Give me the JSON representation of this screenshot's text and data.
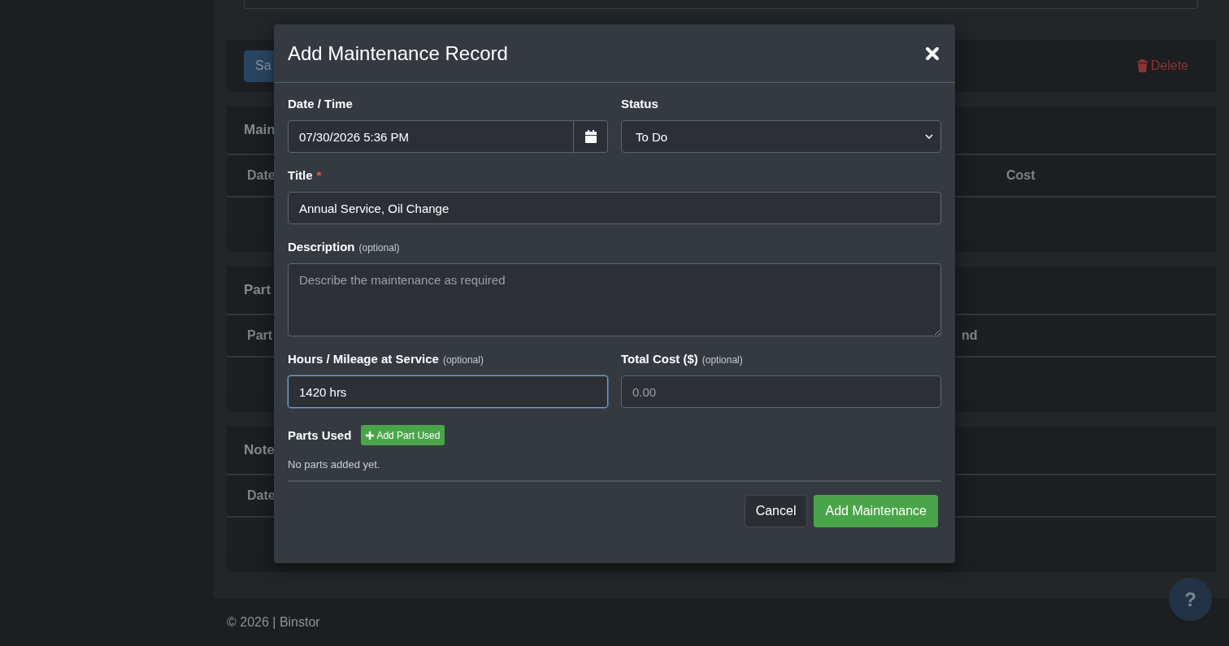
{
  "background": {
    "save_button": "Sa",
    "delete_link": "Delete",
    "sections": [
      {
        "title": "Main",
        "columns": [
          "Date",
          "Cost"
        ]
      },
      {
        "title": "Part",
        "columns": [
          "Part",
          "nd"
        ]
      },
      {
        "title": "Note",
        "columns": [
          "Date"
        ]
      }
    ],
    "footer": "© 2026 | Binstor",
    "help_button": "?"
  },
  "modal": {
    "title": "Add Maintenance Record",
    "date_time": {
      "label": "Date / Time",
      "value": "07/30/2026 5:36 PM"
    },
    "status": {
      "label": "Status",
      "value": "To Do"
    },
    "title_field": {
      "label": "Title",
      "required_mark": "*",
      "value": "Annual Service, Oil Change"
    },
    "description": {
      "label": "Description",
      "hint": "(optional)",
      "placeholder": "Describe the maintenance as required"
    },
    "hours": {
      "label": "Hours / Mileage at Service",
      "hint": "(optional)",
      "value": "1420 hrs",
      "focused": true
    },
    "cost": {
      "label": "Total Cost ($)",
      "hint": "(optional)",
      "placeholder": "0.00",
      "focused": false
    },
    "parts_used": {
      "label": "Parts Used",
      "button": "Add Part Used",
      "empty_text": "No parts added yet."
    },
    "buttons": {
      "cancel": "Cancel",
      "submit": "Add Maintenance"
    }
  }
}
